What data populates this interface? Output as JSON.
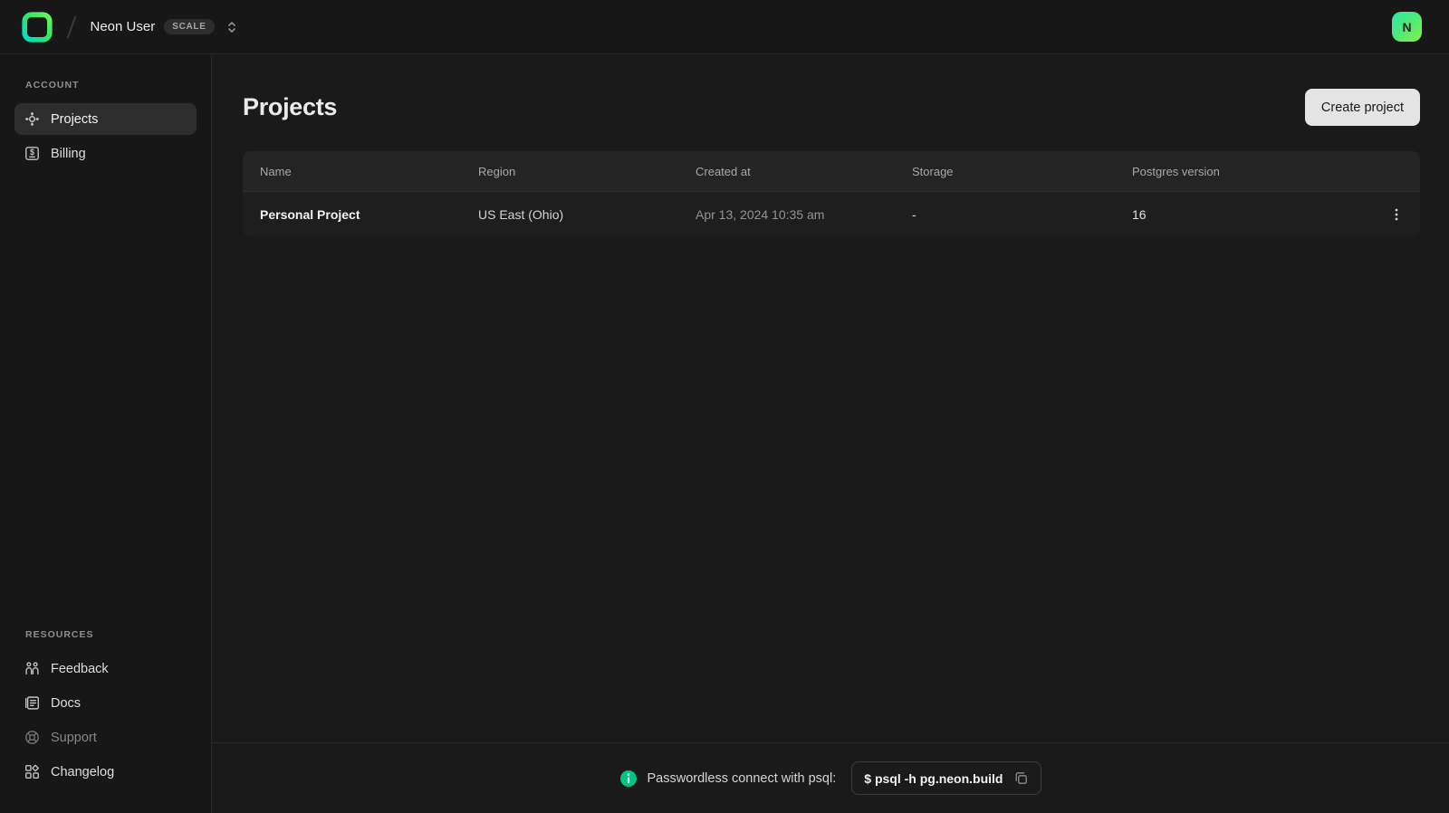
{
  "header": {
    "org_name": "Neon User",
    "plan_badge": "SCALE",
    "avatar_letter": "N",
    "logo_icon": "neon-logo",
    "switcher_icon": "chevron-updown-icon"
  },
  "sidebar": {
    "sections": [
      {
        "label": "ACCOUNT",
        "items": [
          {
            "label": "Projects",
            "icon": "projects-icon",
            "active": true
          },
          {
            "label": "Billing",
            "icon": "billing-icon",
            "active": false
          }
        ]
      },
      {
        "label": "RESOURCES",
        "items": [
          {
            "label": "Feedback",
            "icon": "feedback-icon",
            "active": false
          },
          {
            "label": "Docs",
            "icon": "docs-icon",
            "active": false
          },
          {
            "label": "Support",
            "icon": "support-icon",
            "active": false,
            "muted": true
          },
          {
            "label": "Changelog",
            "icon": "changelog-icon",
            "active": false
          }
        ]
      }
    ]
  },
  "main": {
    "title": "Projects",
    "create_button": "Create project",
    "table": {
      "columns": [
        "Name",
        "Region",
        "Created at",
        "Storage",
        "Postgres version"
      ],
      "rows": [
        {
          "name": "Personal Project",
          "region": "US East (Ohio)",
          "created_at": "Apr 13, 2024 10:35 am",
          "storage": "-",
          "postgres_version": "16",
          "actions_icon": "kebab-menu-icon"
        }
      ]
    }
  },
  "footer": {
    "info_icon": "info-icon",
    "hint": "Passwordless connect with psql:",
    "command": "$ psql -h pg.neon.build",
    "copy_icon": "copy-icon"
  },
  "colors": {
    "brand_accent": "#00e599",
    "avatar_gradient_start": "#2fe5a7",
    "avatar_gradient_end": "#8af244",
    "info_icon_green": "#00c482",
    "page_background": "#1a1a1a",
    "panel_background": "#171717",
    "table_header_background": "#242424",
    "table_row_background": "#1e1e1e",
    "create_button_background": "#e4e4e4"
  }
}
